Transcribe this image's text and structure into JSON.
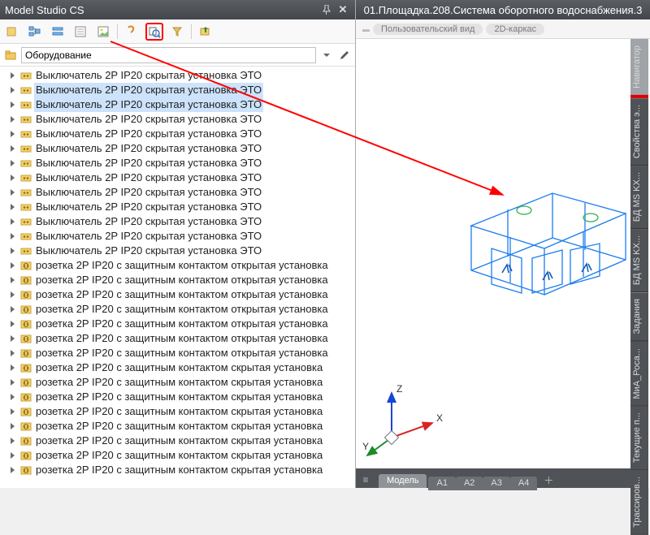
{
  "panel": {
    "title": "Model Studio CS"
  },
  "header_right": "01.Площадка.208.Система оборотного водоснабжения.3",
  "viewbar": {
    "pill1": "Пользовательский вид",
    "pill2": "2D-каркас"
  },
  "filter": {
    "value": "Оборудование"
  },
  "tree": {
    "items": [
      {
        "label": "Выключатель 2P IP20 скрытая установка  ЭТО",
        "type": "sw",
        "selected": false
      },
      {
        "label": "Выключатель 2P IP20 скрытая установка  ЭТО",
        "type": "sw",
        "selected": true
      },
      {
        "label": "Выключатель 2P IP20 скрытая установка  ЭТО",
        "type": "sw",
        "selected": true
      },
      {
        "label": "Выключатель 2P IP20 скрытая установка  ЭТО",
        "type": "sw",
        "selected": false
      },
      {
        "label": "Выключатель 2P IP20 скрытая установка  ЭТО",
        "type": "sw",
        "selected": false
      },
      {
        "label": "Выключатель 2P IP20 скрытая установка  ЭТО",
        "type": "sw",
        "selected": false
      },
      {
        "label": "Выключатель 2P IP20 скрытая установка  ЭТО",
        "type": "sw",
        "selected": false
      },
      {
        "label": "Выключатель 2P IP20 скрытая установка  ЭТО",
        "type": "sw",
        "selected": false
      },
      {
        "label": "Выключатель 2P IP20 скрытая установка  ЭТО",
        "type": "sw",
        "selected": false
      },
      {
        "label": "Выключатель 2P IP20 скрытая установка  ЭТО",
        "type": "sw",
        "selected": false
      },
      {
        "label": "Выключатель 2P IP20 скрытая установка  ЭТО",
        "type": "sw",
        "selected": false
      },
      {
        "label": "Выключатель 2P IP20 скрытая установка  ЭТО",
        "type": "sw",
        "selected": false
      },
      {
        "label": "Выключатель 2P IP20 скрытая установка  ЭТО",
        "type": "sw",
        "selected": false
      },
      {
        "label": "розетка 2P IP20 с защитным контактом  открытая установка",
        "type": "sock",
        "selected": false
      },
      {
        "label": "розетка 2P IP20 с защитным контактом  открытая установка",
        "type": "sock",
        "selected": false
      },
      {
        "label": "розетка 2P IP20 с защитным контактом  открытая установка",
        "type": "sock",
        "selected": false
      },
      {
        "label": "розетка 2P IP20 с защитным контактом  открытая установка",
        "type": "sock",
        "selected": false
      },
      {
        "label": "розетка 2P IP20 с защитным контактом  открытая установка",
        "type": "sock",
        "selected": false
      },
      {
        "label": "розетка 2P IP20 с защитным контактом  открытая установка",
        "type": "sock",
        "selected": false
      },
      {
        "label": "розетка 2P IP20 с защитным контактом  открытая установка",
        "type": "sock",
        "selected": false
      },
      {
        "label": "розетка 2P IP20 с защитным контактом  скрытая установка",
        "type": "sock",
        "selected": false
      },
      {
        "label": "розетка 2P IP20 с защитным контактом  скрытая установка",
        "type": "sock",
        "selected": false
      },
      {
        "label": "розетка 2P IP20 с защитным контактом  скрытая установка",
        "type": "sock",
        "selected": false
      },
      {
        "label": "розетка 2P IP20 с защитным контактом  скрытая установка",
        "type": "sock",
        "selected": false
      },
      {
        "label": "розетка 2P IP20 с защитным контактом  скрытая установка",
        "type": "sock",
        "selected": false
      },
      {
        "label": "розетка 2P IP20 с защитным контактом  скрытая установка",
        "type": "sock",
        "selected": false
      },
      {
        "label": "розетка 2P IP20 с защитным контактом  скрытая установка",
        "type": "sock",
        "selected": false
      },
      {
        "label": "розетка 2P IP20 с защитным контактом  скрытая установка",
        "type": "sock",
        "selected": false
      }
    ]
  },
  "side_tabs": [
    "Навигатор",
    "Свойства э...",
    "БД MS KX...",
    "БД MS KX...",
    "Задания",
    "МиА_Роса...",
    "Текущие п...",
    "Трассиров..."
  ],
  "bottom_tabs": {
    "active": "Модель",
    "others": [
      "A1",
      "A2",
      "A3",
      "A4"
    ]
  },
  "ucs": {
    "x": "X",
    "y": "Y",
    "z": "Z"
  }
}
